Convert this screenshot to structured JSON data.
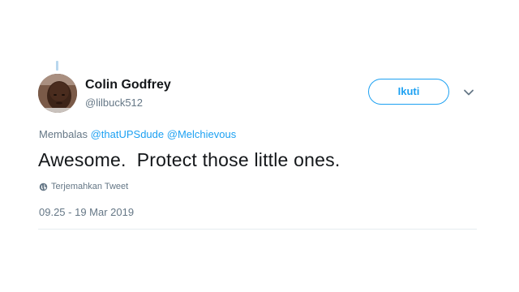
{
  "author": {
    "name": "Colin Godfrey",
    "handle": "@lilbuck512"
  },
  "follow_button": {
    "label": "Ikuti"
  },
  "reply": {
    "prefix": "Membalas",
    "mentions": [
      "@thatUPSdude",
      "@Melchievous"
    ]
  },
  "tweet": {
    "text": "Awesome.  Protect those little ones.",
    "translate_label": "Terjemahkan Tweet",
    "timestamp": "09.25 - 19 Mar 2019"
  },
  "icons": {
    "menu": "chevron-down-icon",
    "translate": "globe-icon"
  },
  "colors": {
    "accent": "#1da1f2",
    "text": "#14171a",
    "secondary": "#657786",
    "divider": "#e6ecf0"
  }
}
